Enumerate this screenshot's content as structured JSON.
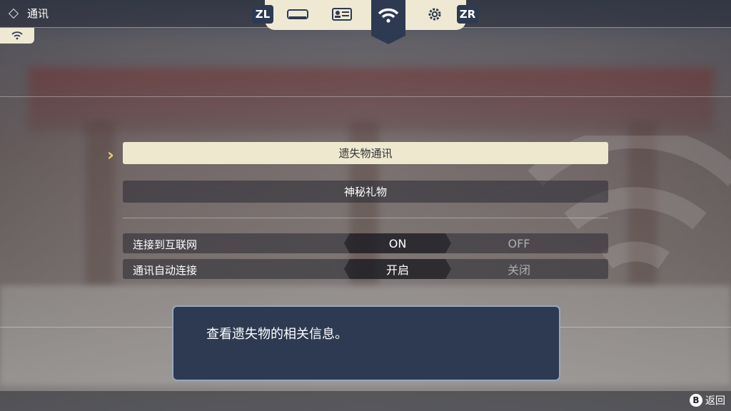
{
  "header": {
    "title": "通讯"
  },
  "tabs": {
    "left_shoulder": "ZL",
    "right_shoulder": "ZR",
    "items": [
      "console-icon",
      "profile-card-icon",
      "wifi-icon",
      "gear-icon"
    ],
    "active": "wifi-icon"
  },
  "menu": {
    "items": [
      {
        "label": "遗失物通讯",
        "selected": true
      },
      {
        "label": "神秘礼物",
        "selected": false
      }
    ]
  },
  "settings": [
    {
      "label": "连接到互联网",
      "on": "ON",
      "off": "OFF",
      "value": "ON"
    },
    {
      "label": "通讯自动连接",
      "on": "开启",
      "off": "关闭",
      "value": "开启"
    }
  ],
  "help": {
    "text": "查看遗失物的相关信息。"
  },
  "footer": {
    "back_key": "B",
    "back_label": "返回"
  },
  "colors": {
    "accent": "#e7d26a",
    "panel": "#2d3a52",
    "cream": "#efe9d4"
  }
}
